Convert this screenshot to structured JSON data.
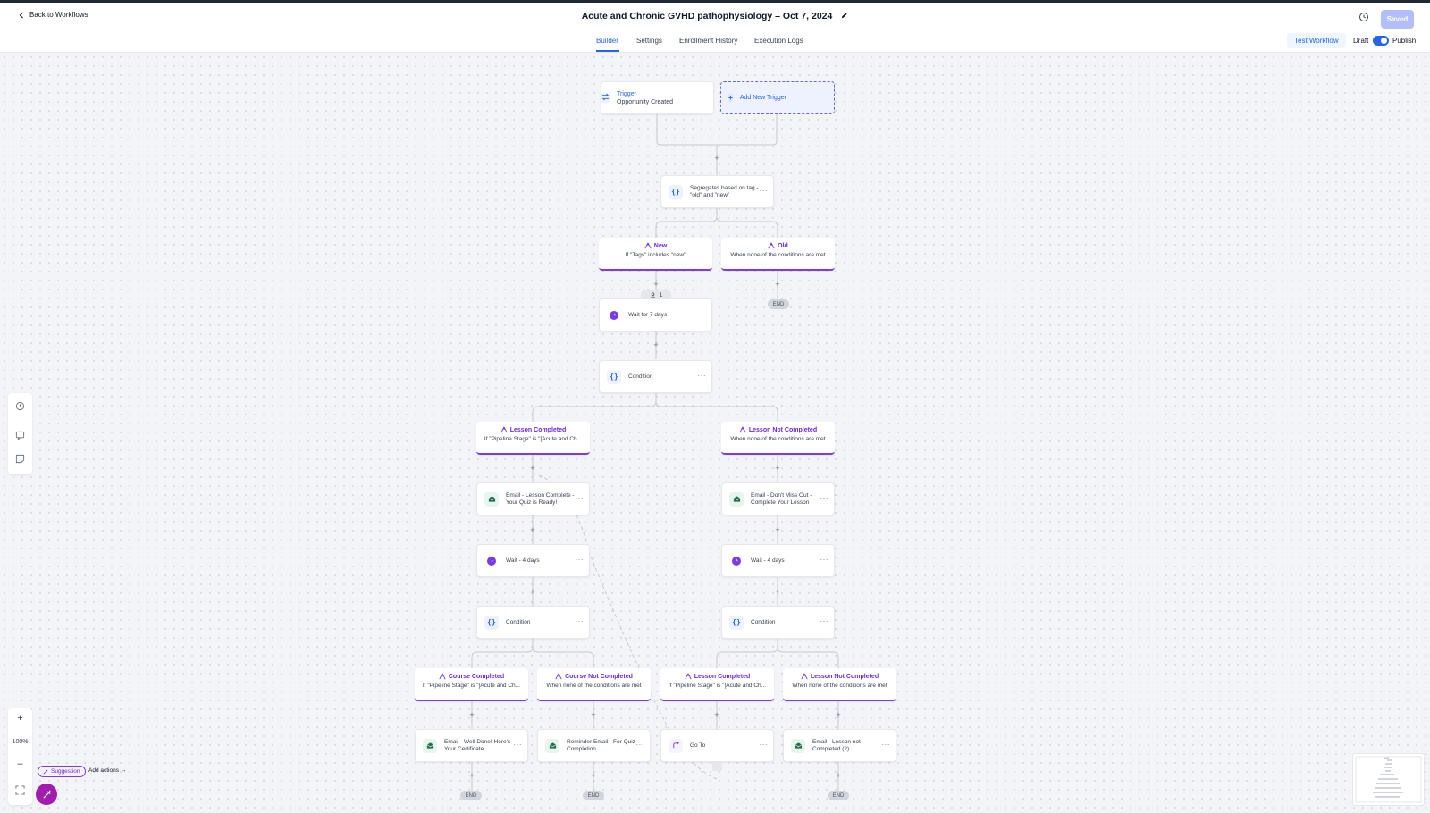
{
  "header": {
    "back_label": "Back to Workflows",
    "title": "Acute and Chronic GVHD pathophysiology – Oct 7, 2024",
    "saved_label": "Saved"
  },
  "tabs": [
    {
      "label": "Builder",
      "active": true
    },
    {
      "label": "Settings"
    },
    {
      "label": "Enrollment History"
    },
    {
      "label": "Execution Logs"
    }
  ],
  "toolbar": {
    "test_label": "Test Workflow",
    "draft_label": "Draft",
    "publish_label": "Publish",
    "toggle_on": true
  },
  "colors": {
    "accent": "#2563eb",
    "branch": "#7c3aed",
    "email_icon": "#1f6f4a"
  },
  "trigger": {
    "label": "Trigger",
    "event": "Opportunity Created",
    "add_label": "Add New Trigger"
  },
  "nodes": {
    "segregate": "Segregates based on tag - \"old\" and \"new\"",
    "wait7": "Wait for 7 days",
    "condition1": "Condition",
    "email_complete": "Email - Lesson Complete - Your Quiz is Ready!",
    "email_dontmiss": "Email - Don't Miss Out - Complete Your Lesson",
    "wait4_left": "Wait - 4 days",
    "wait4_right": "Wait - 4 days",
    "condition_left": "Condition",
    "condition_right": "Condition",
    "email_welldone": "Email - Well Done! Here's Your Certificate",
    "email_reminder": "Reminder Email - For Quiz Completion",
    "goto": "Go To",
    "email_notcompleted": "Email - Lesson not Completed (2)"
  },
  "branches": {
    "new": {
      "title": "New",
      "sub": "If \"Tags\" includes \"new\""
    },
    "old": {
      "title": "Old",
      "sub": "When none of the conditions are met"
    },
    "lesson_completed": {
      "title": "Lesson Completed",
      "sub": "If \"Pipeline Stage\" is \"[Acute and Ch..."
    },
    "lesson_not_completed": {
      "title": "Lesson Not Completed",
      "sub": "When none of the conditions are met"
    },
    "course_completed": {
      "title": "Course Completed",
      "sub": "If \"Pipeline Stage\" is \"[Acute and Ch..."
    },
    "course_not_completed": {
      "title": "Course Not Completed",
      "sub": "When none of the conditions are met"
    },
    "lesson_completed_2": {
      "title": "Lesson Completed",
      "sub": "If \"Pipeline Stage\" is \"[Acute and Ch..."
    },
    "lesson_not_completed_2": {
      "title": "Lesson Not Completed",
      "sub": "When none of the conditions are met"
    }
  },
  "end_label": "END",
  "contact_count": "1",
  "zoom": {
    "level": "100%",
    "plus": "+",
    "minus": "–"
  },
  "suggestion": {
    "label": "Suggestion",
    "add_actions": "Add actions"
  }
}
